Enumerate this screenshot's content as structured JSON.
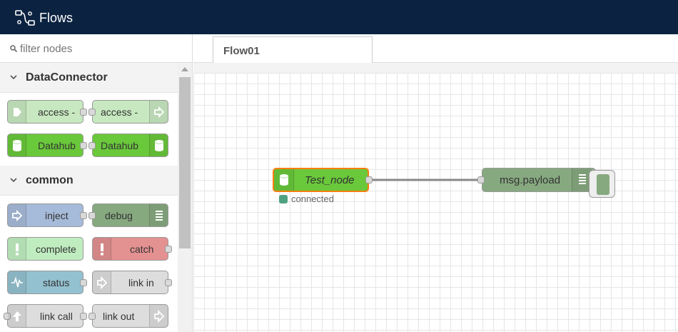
{
  "header": {
    "title": "Flows",
    "logo_icon": "flows-logo-icon"
  },
  "palette": {
    "filter_placeholder": "filter nodes",
    "categories": [
      {
        "label": "DataConnector",
        "expanded": true
      },
      {
        "label": "common",
        "expanded": true
      }
    ],
    "nodes": [
      {
        "label": "access -",
        "color": "#c7e8c0",
        "icon": "arrow-in-icon"
      },
      {
        "label": "access -",
        "color": "#c7e8c0",
        "icon": "arrow-out-icon"
      },
      {
        "label": "Datahub",
        "color": "#6ac83b",
        "icon": "database-icon"
      },
      {
        "label": "Datahub",
        "color": "#6ac83b",
        "icon": "database-icon"
      },
      {
        "label": "inject",
        "color": "#a6bbd9",
        "icon": "arrow-in-icon"
      },
      {
        "label": "debug",
        "color": "#87a980",
        "icon": "list-icon"
      },
      {
        "label": "complete",
        "color": "#c0edc0",
        "icon": "exclamation-icon"
      },
      {
        "label": "catch",
        "color": "#e49191",
        "icon": "exclamation-icon"
      },
      {
        "label": "status",
        "color": "#94c1d0",
        "icon": "pulse-icon"
      },
      {
        "label": "link in",
        "color": "#dddddd",
        "icon": "link-in-icon"
      },
      {
        "label": "link call",
        "color": "#dddddd",
        "icon": "link-call-icon"
      },
      {
        "label": "link out",
        "color": "#dddddd",
        "icon": "link-out-icon"
      }
    ]
  },
  "workspace": {
    "tabs": [
      {
        "label": "Flow01",
        "active": true
      }
    ],
    "flow_nodes": [
      {
        "label": "Test_node",
        "color": "#6ac83b",
        "selected": true,
        "status": "connected",
        "status_color": "#4fa282"
      },
      {
        "label": "msg.payload",
        "color": "#87a980",
        "button_active": true
      }
    ]
  }
}
